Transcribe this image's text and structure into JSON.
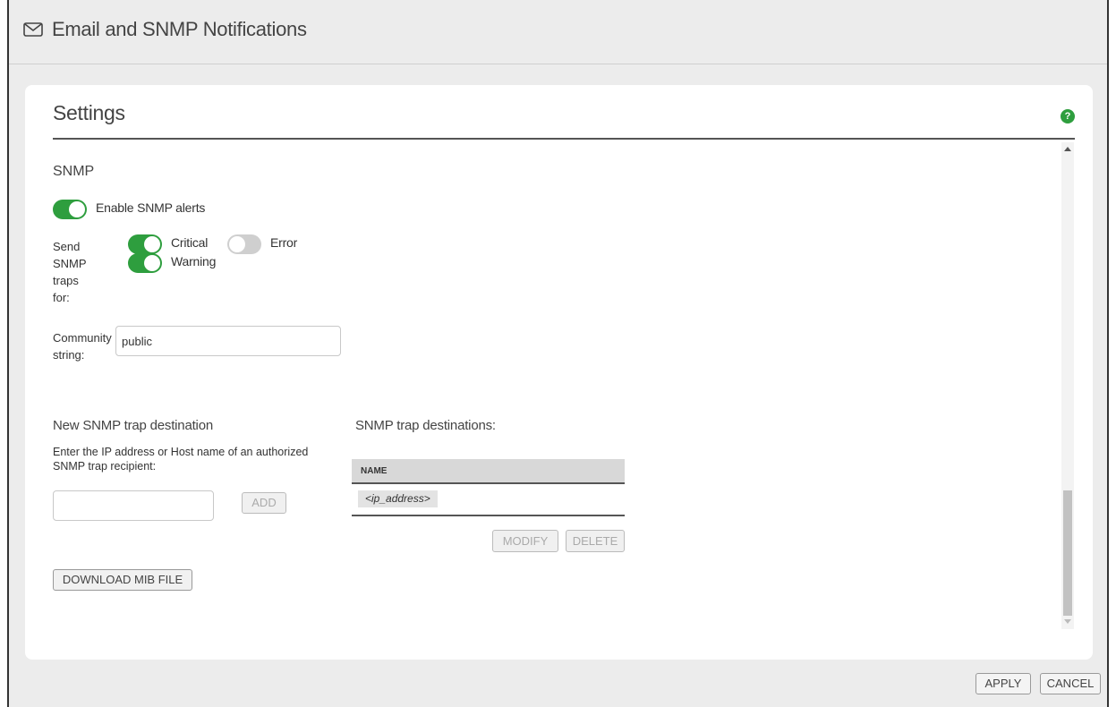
{
  "window": {
    "title": "Email and SNMP Notifications",
    "title_icon": "envelope-icon"
  },
  "card": {
    "title": "Settings",
    "help_icon": "help-icon",
    "help_glyph": "?"
  },
  "snmp": {
    "heading": "SNMP",
    "enable_toggle": {
      "label": "Enable SNMP alerts",
      "on": true
    },
    "send_traps_label": [
      "Send",
      "SNMP",
      "traps",
      "for:"
    ],
    "traps": {
      "critical": {
        "label": "Critical",
        "on": true
      },
      "error": {
        "label": "Error",
        "on": false
      },
      "warning": {
        "label": "Warning",
        "on": true
      }
    },
    "community": {
      "label_line1": "Community",
      "label_line2": "string:",
      "value": "public"
    }
  },
  "new_destination": {
    "heading": "New SNMP trap destination",
    "instructions_line1": "Enter the IP address or Host name of an authorized",
    "instructions_line2": "SNMP trap recipient:",
    "input_value": "",
    "add_label": "ADD"
  },
  "destinations": {
    "heading": "SNMP trap destinations:",
    "column_header": "NAME",
    "rows": [
      "<ip_address>"
    ],
    "modify_label": "MODIFY",
    "delete_label": "DELETE"
  },
  "download_mib_label": "DOWNLOAD MIB FILE",
  "footer": {
    "apply_label": "APPLY",
    "cancel_label": "CANCEL"
  },
  "colors": {
    "accent": "#2e9e3e",
    "toggle_off": "#cfcfcf"
  }
}
